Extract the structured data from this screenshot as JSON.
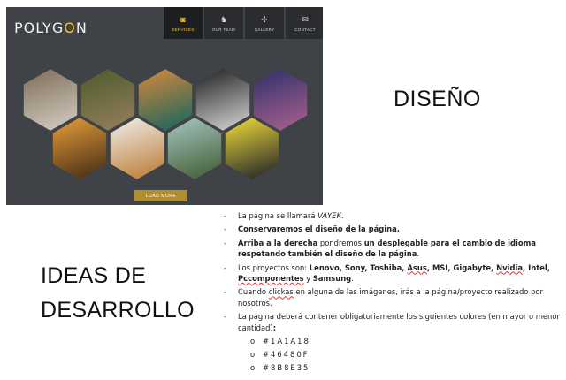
{
  "mockup": {
    "logo": "POLYGON",
    "nav": [
      {
        "label": "SERVICES",
        "icon": "camera-icon",
        "glyph": "◙",
        "active": true
      },
      {
        "label": "OUR TEAM",
        "icon": "team-icon",
        "glyph": "♞",
        "active": false
      },
      {
        "label": "GALLERY",
        "icon": "gallery-icon",
        "glyph": "✣",
        "active": false
      },
      {
        "label": "CONTACT",
        "icon": "mail-icon",
        "glyph": "✉",
        "active": false
      }
    ],
    "load_more": "LOAD MORE",
    "hexagons": [
      {
        "name": "hex-mountain-road",
        "c1": "#7b6a55",
        "c2": "#c9c1b4"
      },
      {
        "name": "hex-tree",
        "c1": "#4c5a2a",
        "c2": "#8c7a56"
      },
      {
        "name": "hex-lake",
        "c1": "#d9893a",
        "c2": "#2f6a5a"
      },
      {
        "name": "hex-dandelion",
        "c1": "#1c1c1c",
        "c2": "#bdbdbd"
      },
      {
        "name": "hex-bridge-night",
        "c1": "#2b2f6a",
        "c2": "#9a5a8a"
      },
      {
        "name": "hex-autumn-leaves",
        "c1": "#e9a13b",
        "c2": "#5a3a1a"
      },
      {
        "name": "hex-cup-table",
        "c1": "#f1f1f1",
        "c2": "#c38a4b"
      },
      {
        "name": "hex-stones",
        "c1": "#a9c9c4",
        "c2": "#4e6a46"
      },
      {
        "name": "hex-teapot",
        "c1": "#f7e23a",
        "c2": "#3a3a2a"
      }
    ]
  },
  "heading_design": "DISEÑO",
  "heading_ideas": "IDEAS DE DESARROLLO",
  "notes": {
    "n1a": "La página se llamará ",
    "n1b": "VAYEK",
    "n1c": ".",
    "n2": "Conservaremos el diseño de la página.",
    "n3a": "Arriba a la derecha",
    "n3b": " pondremos ",
    "n3c": "un desplegable para el cambio de idioma respetando también el diseño de la página",
    "n3d": ".",
    "n4a": "Los proyectos son: ",
    "n4b": "Lenovo, Sony, Toshiba, ",
    "n4c": "Asus",
    "n4d": ", MSI, Gigabyte, ",
    "n4e": "Nvidia",
    "n4f": ", Intel, ",
    "n4g": "Pccomponentes",
    "n4h": " y ",
    "n4i": "Samsung",
    "n4j": ".",
    "n5a": "Cuando ",
    "n5b": "clickas",
    "n5c": " en alguna de las imágenes, irás a la página/proyecto realizado por nosotros.",
    "n6a": "La página deberá contener obligatoriamente los siguientes colores (en mayor o menor cantidad)",
    "n6b": ":"
  },
  "colors": [
    "#1A1A18",
    "#46480F",
    "#8B8E35"
  ]
}
